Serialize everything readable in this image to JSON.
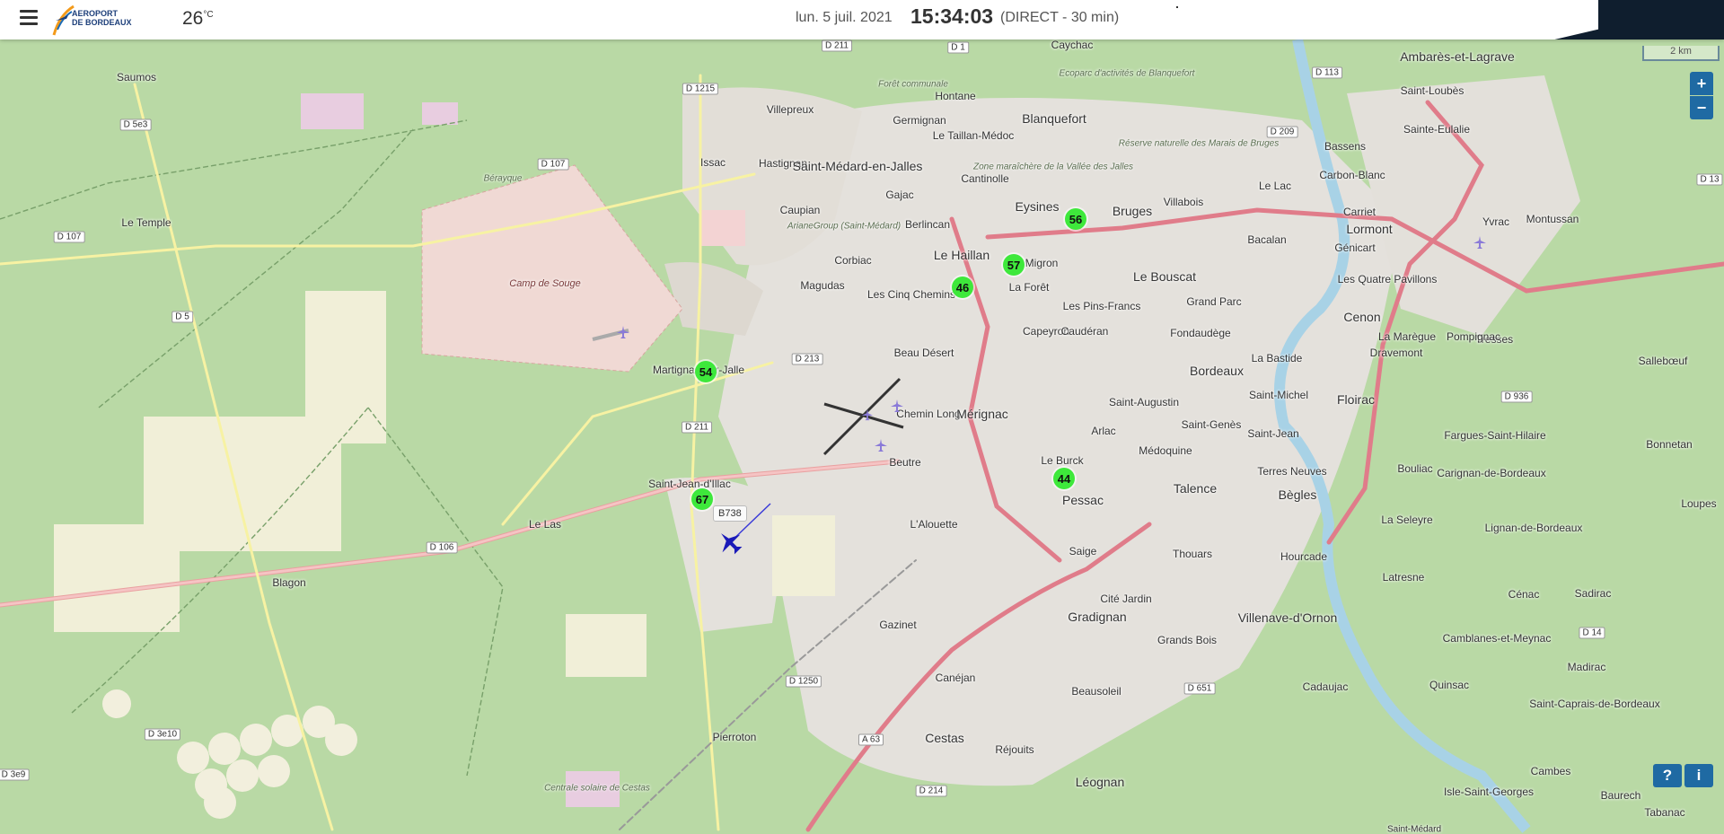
{
  "header": {
    "logo_line1": "AEROPORT",
    "logo_line2": "DE BORDEAUX",
    "temperature_value": "26",
    "temperature_unit": "°C",
    "date": "lun. 5 juil. 2021",
    "time": "15:34:03",
    "mode": "(DIRECT - 30 min)"
  },
  "map_controls": {
    "zoom_in": "+",
    "zoom_out": "−",
    "scale": "2 km",
    "help": "?",
    "info": "i"
  },
  "markers": [
    {
      "value": "56"
    },
    {
      "value": "57"
    },
    {
      "value": "46"
    },
    {
      "value": "54"
    },
    {
      "value": "44"
    },
    {
      "value": "67"
    }
  ],
  "flight": {
    "label": "B738"
  },
  "places": [
    "Saumos",
    "Le Temple",
    "Blagon",
    "Le Las",
    "Pierroton",
    "Cestas",
    "Réjouits",
    "Léognan",
    "Gazinet",
    "Canéjan",
    "Beausoleil",
    "Gradignan",
    "Cité Jardin",
    "Grands Bois",
    "Villenave-d'Ornon",
    "Thouars",
    "Talence",
    "Bègles",
    "Hourcade",
    "Pessac",
    "Saige",
    "L'Alouette",
    "Le Burck",
    "Beutre",
    "Chemin Long",
    "Mérignac",
    "Beau Désert",
    "Capeyron",
    "La Forêt",
    "Le Haillan",
    "Les Cinq Chemins",
    "Magudas",
    "Corbiac",
    "Berlincan",
    "Caupian",
    "Hastignan",
    "Saint-Médard-en-Jalles",
    "Gajac",
    "Cantinolle",
    "Eysines",
    "Migron",
    "Bruges",
    "Villabois",
    "Le Bouscat",
    "Les Pins-Francs",
    "Caudéran",
    "Fondaudège",
    "Bordeaux",
    "Grand Parc",
    "Saint-Michel",
    "Saint-Genès",
    "Saint-Augustin",
    "Arlac",
    "Médoquine",
    "Saint-Jean",
    "Terres Neuves",
    "La Bastide",
    "Cenon",
    "Floirac",
    "Lormont",
    "Carriet",
    "Génicart",
    "Les Quatre Pavillons",
    "La Marègue",
    "Dravemont",
    "Bacalan",
    "Le Lac",
    "Bassens",
    "Carbon-Blanc",
    "Sainte-Eulalie",
    "Saint-Loubès",
    "Ambarès-et-Lagrave",
    "Yvrac",
    "Montussan",
    "Tresses",
    "Pompignac",
    "Sallebœuf",
    "Fargues-Saint-Hilaire",
    "Bonnetan",
    "Carignan-de-Bordeaux",
    "Bouliac",
    "La Seleyre",
    "Lignan-de-Bordeaux",
    "Loupes",
    "Latresne",
    "Cénac",
    "Sadirac",
    "Camblanes-et-Meynac",
    "Quinsac",
    "Madirac",
    "Saint-Caprais-de-Bordeaux",
    "Cambes",
    "Baurech",
    "Isle-Saint-Georges",
    "Tabanac",
    "Cadaujac",
    "Blanquefort",
    "Germignan",
    "Hontane",
    "Villepreux",
    "Caychac",
    "Le Taillan-Médoc",
    "Issac",
    "Martignas-sur-Jalle",
    "Saint-Jean-d'Illac",
    "Saint-Médard"
  ],
  "map_annotations": [
    "Camp de Souge",
    "Forêt communale",
    "Ecoparc d'activités de Blanquefort",
    "Réserve naturelle des Marais de Bruges",
    "Zone maraîchère de la Vallée des Jalles",
    "ArianeGroup (Saint-Médard)",
    "Bérayque",
    "Centrale solaire de Cestas"
  ],
  "roads": [
    "D 211",
    "D 1",
    "D 1215",
    "D 107",
    "D 5e3",
    "D 107",
    "D 5",
    "D 213",
    "D 211",
    "D 106",
    "D 3e10",
    "D 3e9",
    "D 1250",
    "A 63",
    "D 214",
    "D 651",
    "D 113",
    "D 209",
    "D 13",
    "D 936",
    "D 14"
  ]
}
